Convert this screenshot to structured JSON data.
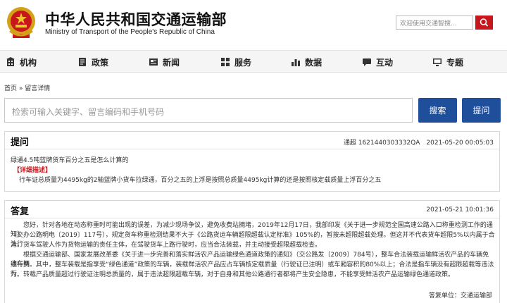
{
  "header": {
    "title_cn": "中华人民共和国交通运输部",
    "title_en": "Ministry of Transport of the People's Republic of China",
    "search_placeholder": "欢迎使用交通智搜...",
    "colors": {
      "brand_red": "#c8161d",
      "button_blue": "#1f4f9b"
    }
  },
  "nav": {
    "items": [
      {
        "label": "机构",
        "icon": "building-icon"
      },
      {
        "label": "政策",
        "icon": "document-icon"
      },
      {
        "label": "新闻",
        "icon": "newspaper-icon"
      },
      {
        "label": "服务",
        "icon": "grid-icon"
      },
      {
        "label": "数据",
        "icon": "bar-chart-icon"
      },
      {
        "label": "互动",
        "icon": "chat-icon"
      },
      {
        "label": "专题",
        "icon": "monitor-icon"
      }
    ]
  },
  "breadcrumb": "首页 » 留言详情",
  "query": {
    "placeholder": "检索可输入关键字、留言编码和手机号码",
    "search_label": "搜索",
    "ask_label": "提问"
  },
  "question": {
    "heading": "提问",
    "meta": "通超 1621440303332QA　2021-05-20 00:05:03",
    "title": "绿通4.5吨蓝牌货车百分之五是怎么计算的",
    "detail_label": "【详细描述】",
    "body": "行车证总质量为4495kg的2轴蓝牌小货车拉绿通，百分之五的上浮是按照总质量4495kg计算的还是按照核定载质量上浮百分之五"
  },
  "answer": {
    "heading": "答复",
    "date": "2021-05-21 10:01:36",
    "lines": [
      "　　您好，针对各地在动态称重时可能出现的误差，为减少现场争议，避免收费站拥堵，2019年12月17日，我部印发《关于进一步规范全国高速公路入口称重检测工作的通知》",
      "（交办公路明电〔2019〕117号），规定货车称重检测结果不大于《公路货运车辆超限超载认定标准》105%的，暂按未超限超载处理。但这并不代表货车超限5%以内属于合法行",
      "为。货车驾驶人作为货物运输的责任主体，在驾驶货车上路行驶时，应当合法装载，并主动接受超限超载检查。",
      "　　根据交通运输部、国家发展改革委《关于进一步完善和落实鲜活农产品运输绿色通道政策的通知》（交公路发〔2009〕784号），整车合法装载运输鲜活农产品的车辆免收车辆",
      "通行费。其中，整车装载是指享受“绿色通道”政策的车辆，装载鲜活农产品应占车辆核定载质量（行驶证已注明）或车厢容积的80%以上；合法是指车辆没有超限超载等违法行",
      "为。转载产品质量超过行驶证注明总质量的，属于违法超限超载车辆，对于自身和其他公路通行者都将产生安全隐患，不能享受鲜活农产品运输绿色通道政策。"
    ],
    "signature": "答复单位：交通运输部"
  }
}
